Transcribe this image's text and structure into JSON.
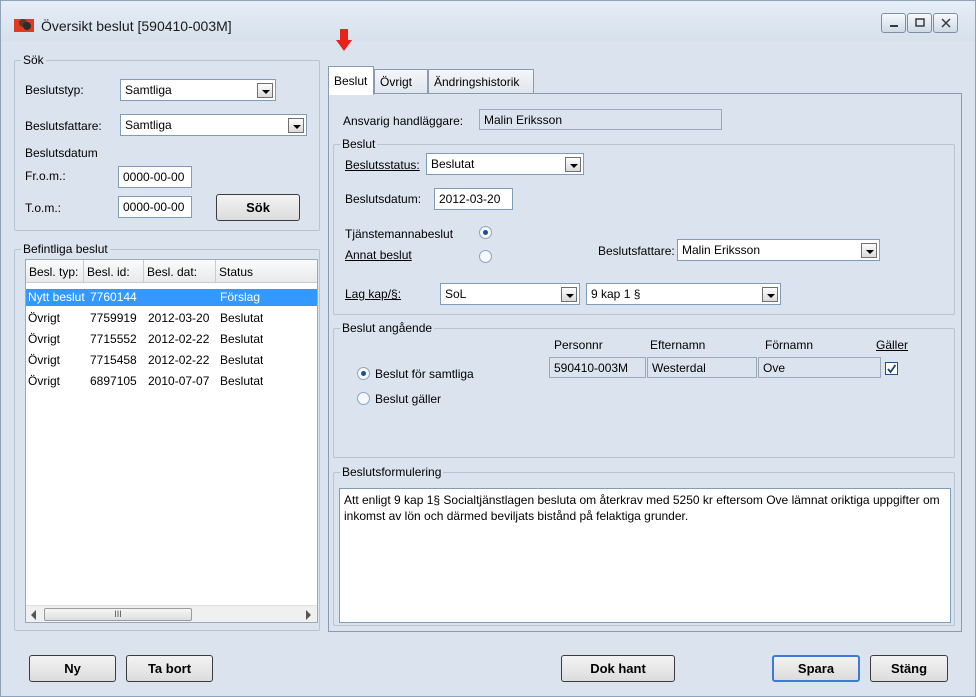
{
  "window": {
    "title": "Översikt beslut  [590410-003M]"
  },
  "search": {
    "group_label": "Sök",
    "beslutstyp_label": "Beslutstyp:",
    "beslutstyp_value": "Samtliga",
    "beslutsfattare_label": "Beslutsfattare:",
    "beslutsfattare_value": "Samtliga",
    "beslutsdatum_label": "Beslutsdatum",
    "from_label": "Fr.o.m.:",
    "from_value": "0000-00-00",
    "tom_label": "T.o.m.:",
    "tom_value": "0000-00-00",
    "search_button": "Sök"
  },
  "existing": {
    "group_label": "Befintliga beslut",
    "columns": [
      "Besl. typ:",
      "Besl. id:",
      "Besl. dat:",
      "Status"
    ],
    "rows": [
      {
        "typ": "Nytt beslut",
        "id": "7760144",
        "dat": "",
        "status": "Förslag"
      },
      {
        "typ": "Övrigt",
        "id": "7759919",
        "dat": "2012-03-20",
        "status": "Beslutat"
      },
      {
        "typ": "Övrigt",
        "id": "7715552",
        "dat": "2012-02-22",
        "status": "Beslutat"
      },
      {
        "typ": "Övrigt",
        "id": "7715458",
        "dat": "2012-02-22",
        "status": "Beslutat"
      },
      {
        "typ": "Övrigt",
        "id": "6897105",
        "dat": "2010-07-07",
        "status": "Beslutat"
      }
    ],
    "scroll_thumb": "III"
  },
  "tabs": [
    "Beslut",
    "Övrigt",
    "Ändringshistorik"
  ],
  "beslut": {
    "ansvarig_label": "Ansvarig handläggare:",
    "ansvarig_value": "Malin Eriksson",
    "group_label": "Beslut",
    "status_label": "Beslutsstatus:",
    "status_value": "Beslutat",
    "datum_label": "Beslutsdatum:",
    "datum_value": "2012-03-20",
    "tjanstemanna_label": "Tjänstemannabeslut",
    "annat_label": "Annat beslut",
    "beslutsfattare_label": "Beslutsfattare:",
    "beslutsfattare_value": "Malin Eriksson",
    "lagkap_label": "Lag kap/§:",
    "lag_value": "SoL",
    "kap_value": "9 kap 1 §"
  },
  "angaende": {
    "group_label": "Beslut angående",
    "radio_all": "Beslut för samtliga",
    "radio_galler": "Beslut gäller",
    "col_personnr": "Personnr",
    "col_efternamn": "Efternamn",
    "col_fornamn": "Förnamn",
    "col_galler": "Gäller",
    "personnr": "590410-003M",
    "efternamn": "Westerdal",
    "fornamn": "Ove",
    "galler_checked": true
  },
  "formulering": {
    "group_label": "Beslutsformulering",
    "text": "Att enligt 9 kap 1§ Socialtjänstlagen besluta om återkrav med 5250 kr eftersom Ove lämnat oriktiga uppgifter om inkomst av lön och därmed beviljats bistånd på felaktiga grunder."
  },
  "footer": {
    "ny": "Ny",
    "ta_bort": "Ta bort",
    "dok_hant": "Dok hant",
    "spara": "Spara",
    "stang": "Stäng"
  },
  "colors": {
    "window_bg": "#dbe4ee",
    "selection": "#3399ff",
    "arrow": "#e8231c"
  }
}
